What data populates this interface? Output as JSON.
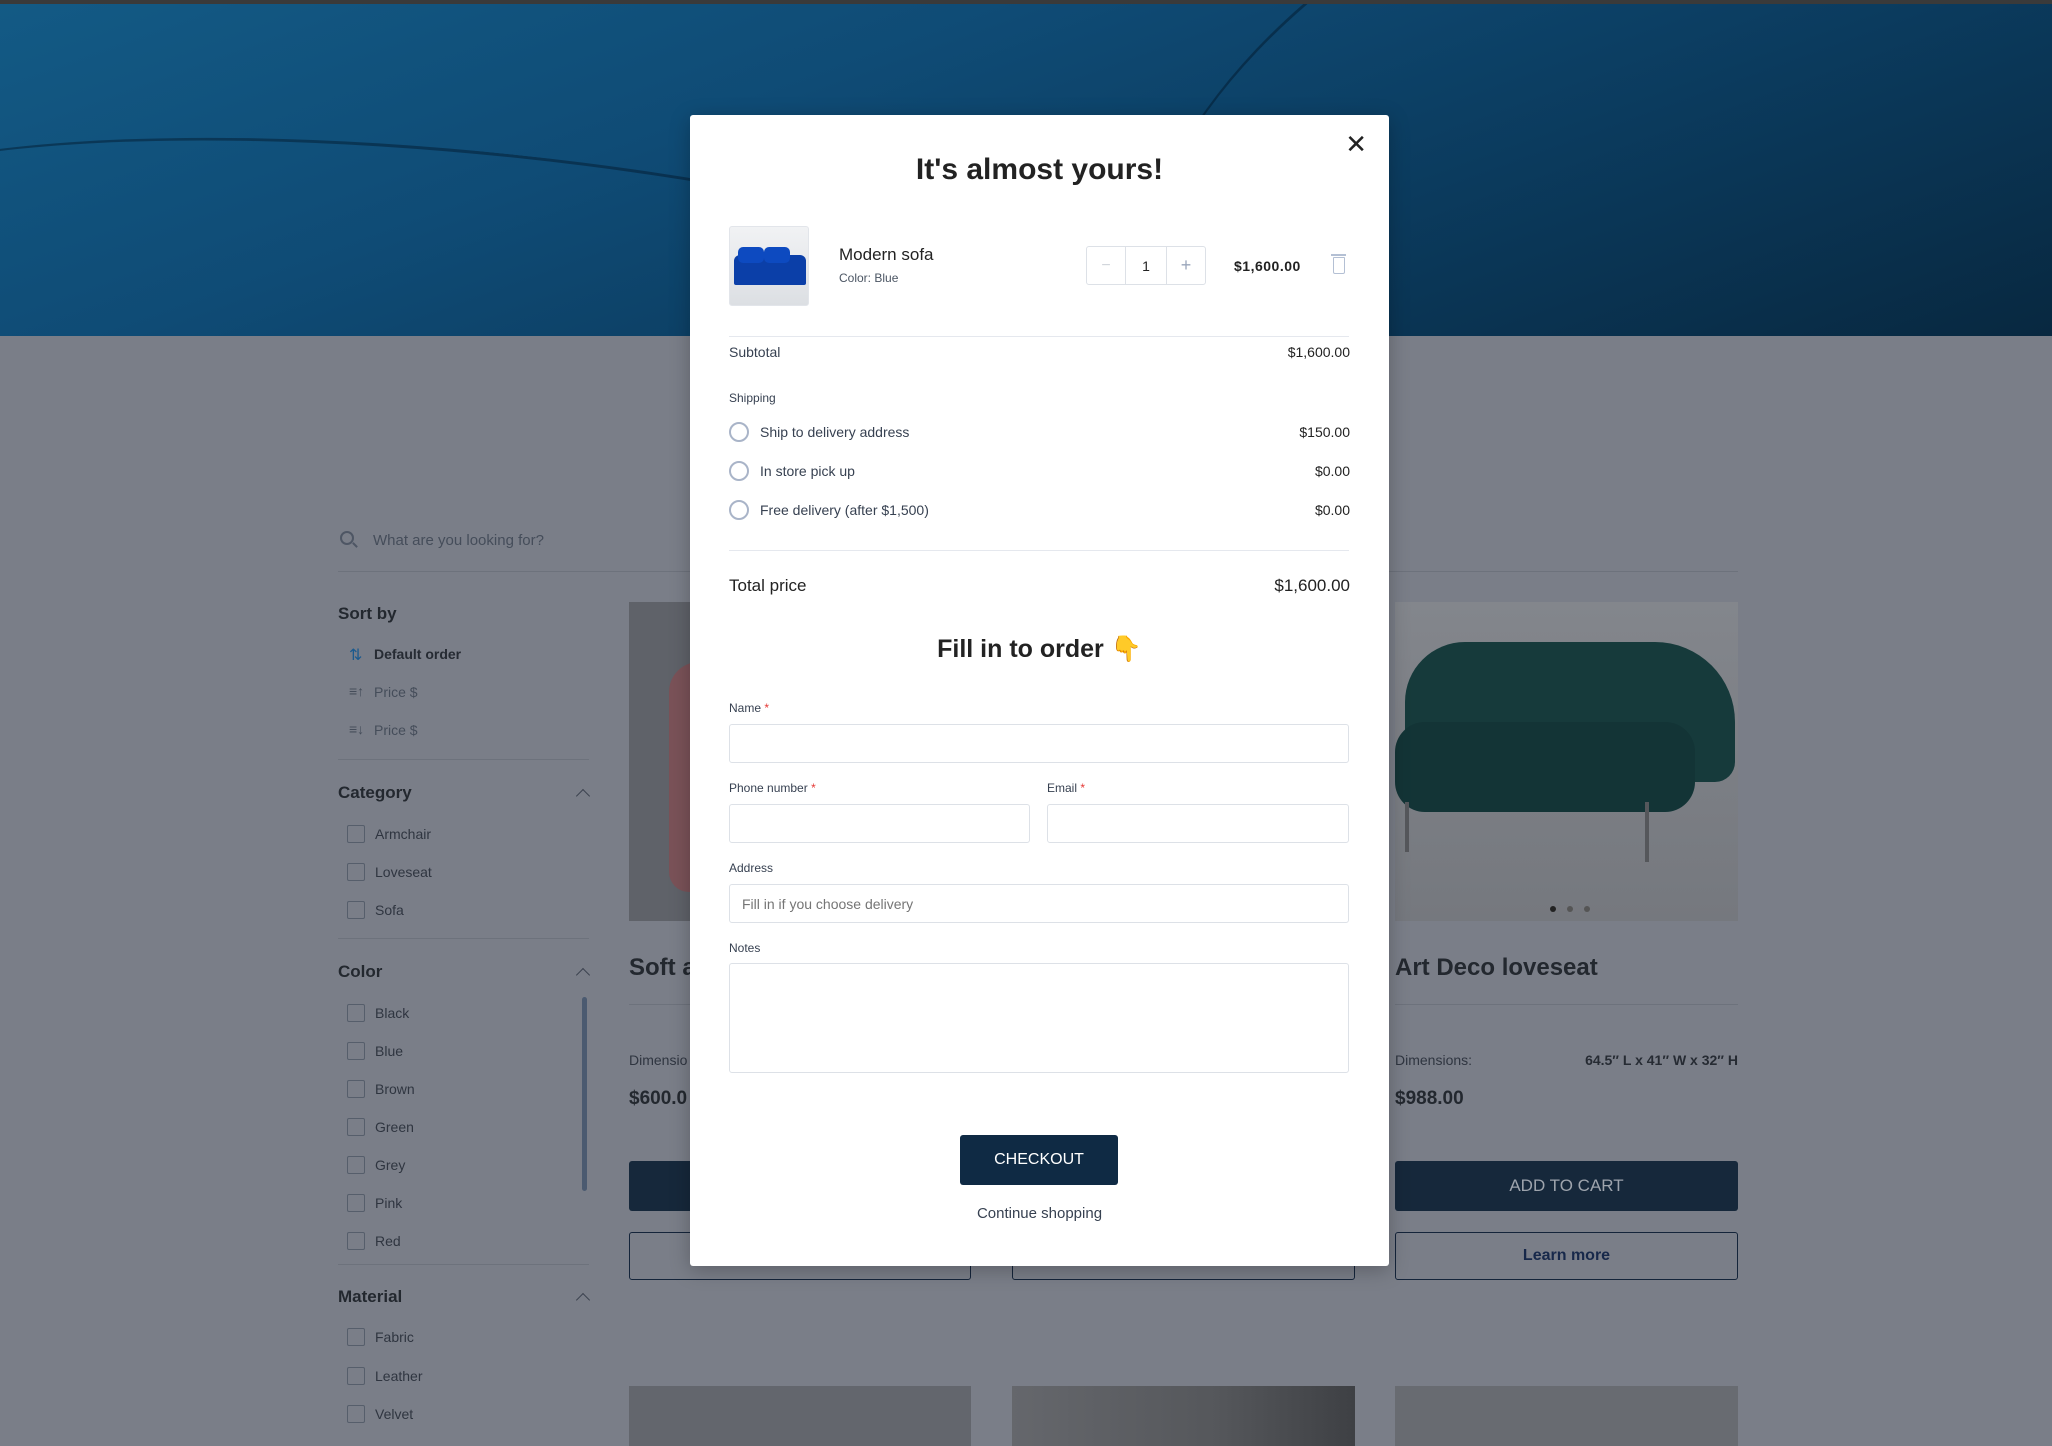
{
  "page": {
    "search": {
      "placeholder": "What are you looking for?"
    },
    "sort": {
      "title": "Sort by",
      "items": [
        "Default order",
        "Price $",
        "Price $"
      ]
    },
    "filters": [
      {
        "title": "Category",
        "options": [
          "Armchair",
          "Loveseat",
          "Sofa"
        ]
      },
      {
        "title": "Color",
        "options": [
          "Black",
          "Blue",
          "Brown",
          "Green",
          "Grey",
          "Pink",
          "Red"
        ]
      },
      {
        "title": "Material",
        "options": [
          "Fabric",
          "Leather",
          "Velvet"
        ]
      }
    ],
    "products": [
      {
        "title": "Soft a",
        "dimensions_label": "Dimensio",
        "price": "$600.0"
      },
      {
        "title": "Art Deco loveseat",
        "dimensions_label": "Dimensions:",
        "dimensions": "64.5″ L x 41″ W x 32″ H",
        "price": "$988.00",
        "add_to_cart": "ADD TO CART",
        "learn_more": "Learn more"
      }
    ]
  },
  "modal": {
    "title": "It's almost yours!",
    "item": {
      "name": "Modern sofa",
      "color": "Color: Blue",
      "quantity": "1",
      "price": "$1,600.00",
      "minus": "−",
      "plus": "+"
    },
    "subtotal": {
      "label": "Subtotal",
      "value": "$1,600.00"
    },
    "shipping": {
      "label": "Shipping",
      "options": [
        {
          "label": "Ship to delivery address",
          "price": "$150.00"
        },
        {
          "label": "In store pick up",
          "price": "$0.00"
        },
        {
          "label": "Free delivery (after $1,500)",
          "price": "$0.00"
        }
      ]
    },
    "total": {
      "label": "Total price",
      "value": "$1,600.00"
    },
    "form": {
      "title": "Fill in to order 👇",
      "required_mark": "*",
      "name_label": "Name",
      "phone_label": "Phone number",
      "email_label": "Email",
      "address_label": "Address",
      "address_placeholder": "Fill in if you choose delivery",
      "notes_label": "Notes"
    },
    "checkout": "CHECKOUT",
    "continue": "Continue shopping"
  },
  "colors": {
    "primary": "#0f2a44",
    "required": "#e53935",
    "accent": "#1e73be"
  }
}
